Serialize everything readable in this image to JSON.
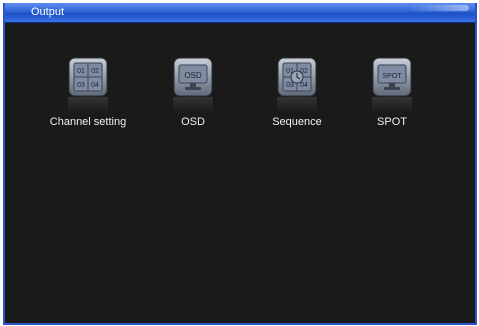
{
  "window": {
    "title": "Output"
  },
  "items": [
    {
      "label": "Channel setting",
      "icon": "channel-grid-icon",
      "cells": [
        "01",
        "02",
        "03",
        "04"
      ]
    },
    {
      "label": "OSD",
      "icon": "osd-monitor-icon",
      "screen_text": "OSD"
    },
    {
      "label": "Sequence",
      "icon": "sequence-grid-icon",
      "cells": [
        "01",
        "02",
        "03",
        "04"
      ]
    },
    {
      "label": "SPOT",
      "icon": "spot-monitor-icon",
      "screen_text": "SPOT"
    }
  ],
  "colors": {
    "titlebar": "#2f64d6",
    "background": "#1a1a1a",
    "icon_face": "#8a96a8"
  }
}
